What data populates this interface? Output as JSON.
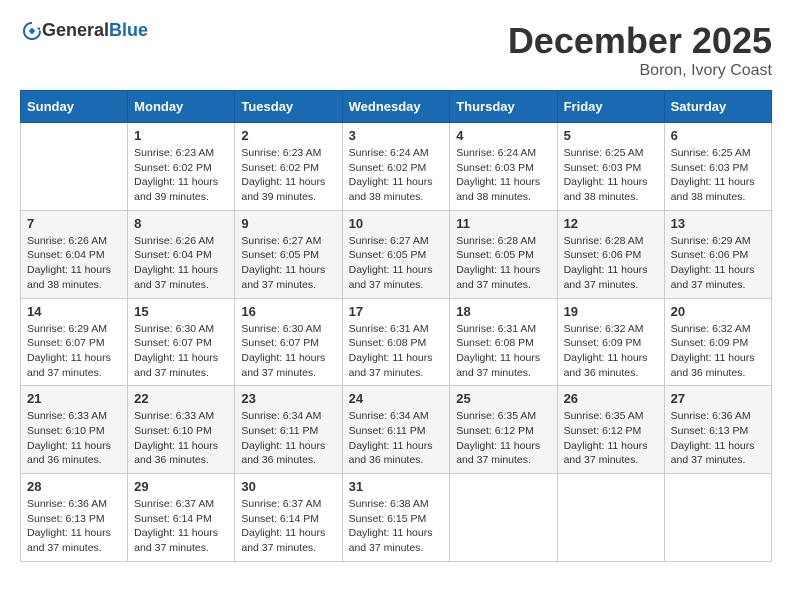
{
  "logo": {
    "general": "General",
    "blue": "Blue"
  },
  "title": {
    "month": "December 2025",
    "location": "Boron, Ivory Coast"
  },
  "days_of_week": [
    "Sunday",
    "Monday",
    "Tuesday",
    "Wednesday",
    "Thursday",
    "Friday",
    "Saturday"
  ],
  "weeks": [
    [
      {
        "day": "",
        "info": ""
      },
      {
        "day": "1",
        "info": "Sunrise: 6:23 AM\nSunset: 6:02 PM\nDaylight: 11 hours and 39 minutes."
      },
      {
        "day": "2",
        "info": "Sunrise: 6:23 AM\nSunset: 6:02 PM\nDaylight: 11 hours and 39 minutes."
      },
      {
        "day": "3",
        "info": "Sunrise: 6:24 AM\nSunset: 6:02 PM\nDaylight: 11 hours and 38 minutes."
      },
      {
        "day": "4",
        "info": "Sunrise: 6:24 AM\nSunset: 6:03 PM\nDaylight: 11 hours and 38 minutes."
      },
      {
        "day": "5",
        "info": "Sunrise: 6:25 AM\nSunset: 6:03 PM\nDaylight: 11 hours and 38 minutes."
      },
      {
        "day": "6",
        "info": "Sunrise: 6:25 AM\nSunset: 6:03 PM\nDaylight: 11 hours and 38 minutes."
      }
    ],
    [
      {
        "day": "7",
        "info": "Sunrise: 6:26 AM\nSunset: 6:04 PM\nDaylight: 11 hours and 38 minutes."
      },
      {
        "day": "8",
        "info": "Sunrise: 6:26 AM\nSunset: 6:04 PM\nDaylight: 11 hours and 37 minutes."
      },
      {
        "day": "9",
        "info": "Sunrise: 6:27 AM\nSunset: 6:05 PM\nDaylight: 11 hours and 37 minutes."
      },
      {
        "day": "10",
        "info": "Sunrise: 6:27 AM\nSunset: 6:05 PM\nDaylight: 11 hours and 37 minutes."
      },
      {
        "day": "11",
        "info": "Sunrise: 6:28 AM\nSunset: 6:05 PM\nDaylight: 11 hours and 37 minutes."
      },
      {
        "day": "12",
        "info": "Sunrise: 6:28 AM\nSunset: 6:06 PM\nDaylight: 11 hours and 37 minutes."
      },
      {
        "day": "13",
        "info": "Sunrise: 6:29 AM\nSunset: 6:06 PM\nDaylight: 11 hours and 37 minutes."
      }
    ],
    [
      {
        "day": "14",
        "info": "Sunrise: 6:29 AM\nSunset: 6:07 PM\nDaylight: 11 hours and 37 minutes."
      },
      {
        "day": "15",
        "info": "Sunrise: 6:30 AM\nSunset: 6:07 PM\nDaylight: 11 hours and 37 minutes."
      },
      {
        "day": "16",
        "info": "Sunrise: 6:30 AM\nSunset: 6:07 PM\nDaylight: 11 hours and 37 minutes."
      },
      {
        "day": "17",
        "info": "Sunrise: 6:31 AM\nSunset: 6:08 PM\nDaylight: 11 hours and 37 minutes."
      },
      {
        "day": "18",
        "info": "Sunrise: 6:31 AM\nSunset: 6:08 PM\nDaylight: 11 hours and 37 minutes."
      },
      {
        "day": "19",
        "info": "Sunrise: 6:32 AM\nSunset: 6:09 PM\nDaylight: 11 hours and 36 minutes."
      },
      {
        "day": "20",
        "info": "Sunrise: 6:32 AM\nSunset: 6:09 PM\nDaylight: 11 hours and 36 minutes."
      }
    ],
    [
      {
        "day": "21",
        "info": "Sunrise: 6:33 AM\nSunset: 6:10 PM\nDaylight: 11 hours and 36 minutes."
      },
      {
        "day": "22",
        "info": "Sunrise: 6:33 AM\nSunset: 6:10 PM\nDaylight: 11 hours and 36 minutes."
      },
      {
        "day": "23",
        "info": "Sunrise: 6:34 AM\nSunset: 6:11 PM\nDaylight: 11 hours and 36 minutes."
      },
      {
        "day": "24",
        "info": "Sunrise: 6:34 AM\nSunset: 6:11 PM\nDaylight: 11 hours and 36 minutes."
      },
      {
        "day": "25",
        "info": "Sunrise: 6:35 AM\nSunset: 6:12 PM\nDaylight: 11 hours and 37 minutes."
      },
      {
        "day": "26",
        "info": "Sunrise: 6:35 AM\nSunset: 6:12 PM\nDaylight: 11 hours and 37 minutes."
      },
      {
        "day": "27",
        "info": "Sunrise: 6:36 AM\nSunset: 6:13 PM\nDaylight: 11 hours and 37 minutes."
      }
    ],
    [
      {
        "day": "28",
        "info": "Sunrise: 6:36 AM\nSunset: 6:13 PM\nDaylight: 11 hours and 37 minutes."
      },
      {
        "day": "29",
        "info": "Sunrise: 6:37 AM\nSunset: 6:14 PM\nDaylight: 11 hours and 37 minutes."
      },
      {
        "day": "30",
        "info": "Sunrise: 6:37 AM\nSunset: 6:14 PM\nDaylight: 11 hours and 37 minutes."
      },
      {
        "day": "31",
        "info": "Sunrise: 6:38 AM\nSunset: 6:15 PM\nDaylight: 11 hours and 37 minutes."
      },
      {
        "day": "",
        "info": ""
      },
      {
        "day": "",
        "info": ""
      },
      {
        "day": "",
        "info": ""
      }
    ]
  ]
}
